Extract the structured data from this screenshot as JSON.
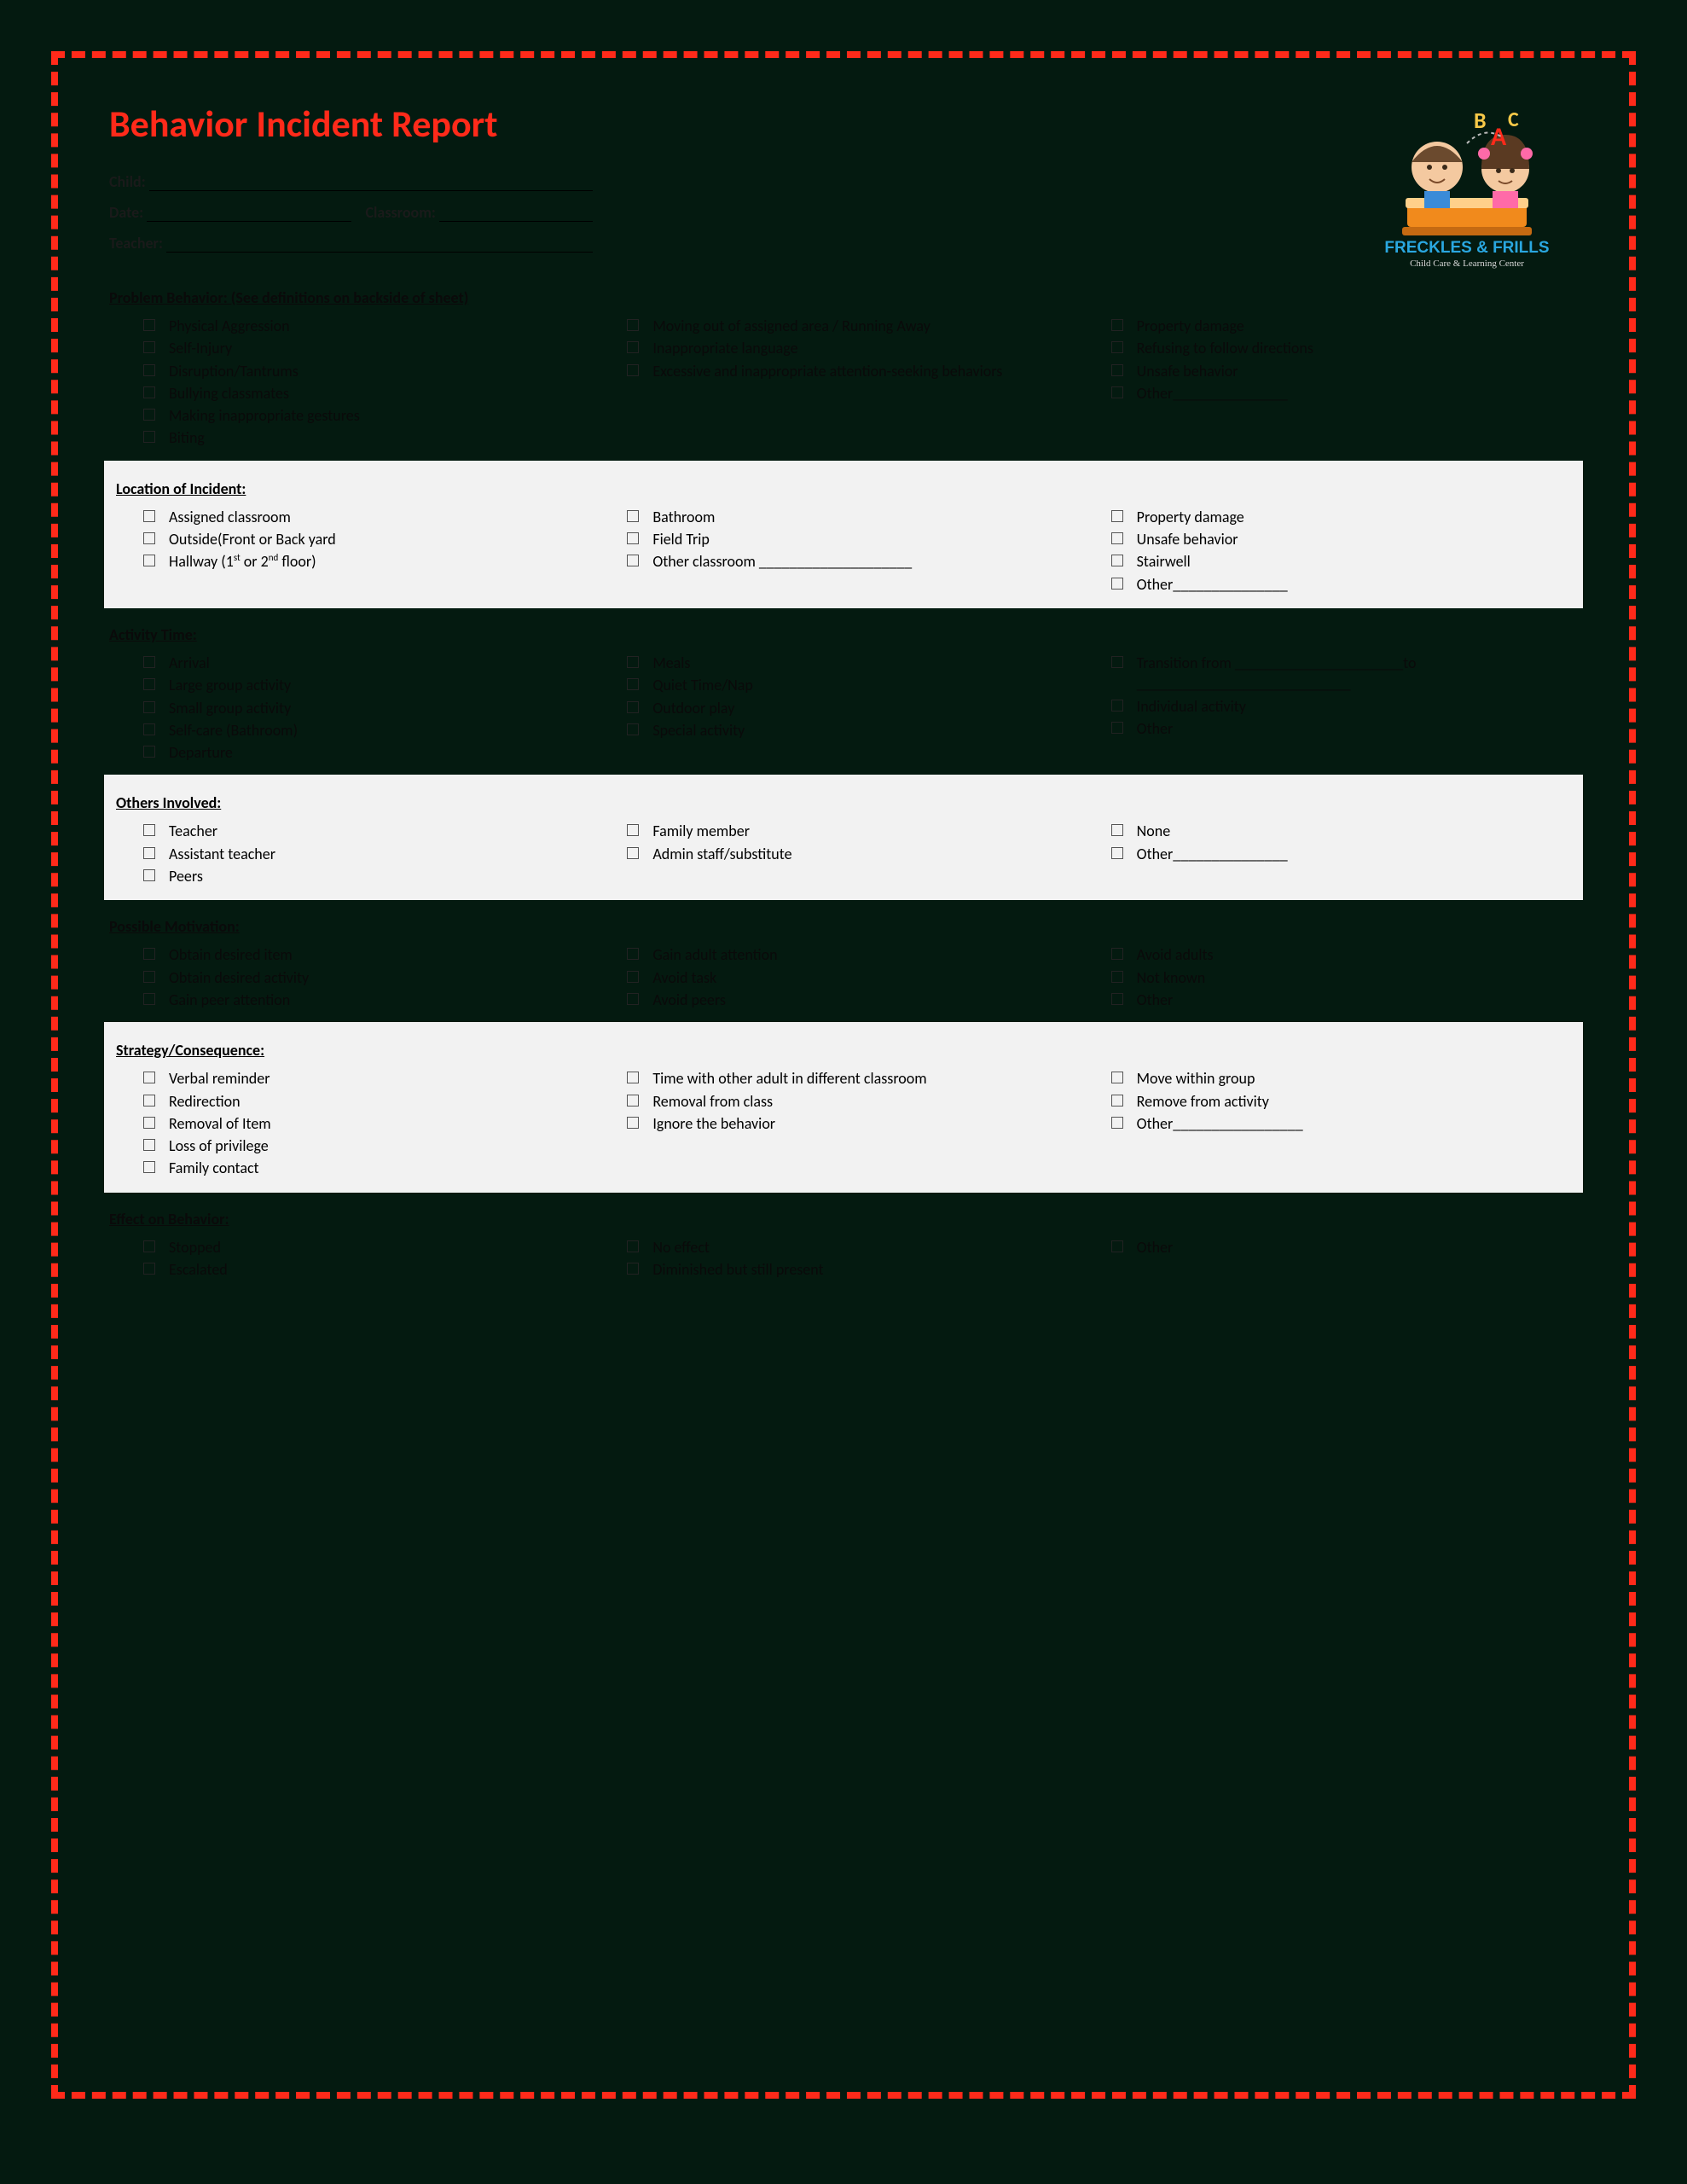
{
  "title": "Behavior Incident Report",
  "logo": {
    "brand_top": "FRECKLES & FRILLS",
    "brand_sub": "Child Care & Learning Center"
  },
  "fields": {
    "child_label": "Child:",
    "date_label": "Date:",
    "classroom_label": "Classroom:",
    "teacher_label": "Teacher:"
  },
  "sections": {
    "problem": {
      "heading": "Problem Behavior: (See definitions on backside of sheet)",
      "c1": [
        "Physical Aggression",
        "Self-Injury",
        "Disruption/Tantrums",
        "Bullying classmates",
        "Making inappropriate gestures",
        "Biting"
      ],
      "c2": [
        "Moving out of assigned area / Running Away",
        "Inappropriate language",
        "Excessive and inappropriate attention-seeking behaviors"
      ],
      "c3": [
        "Property damage",
        "Refusing to follow directions",
        "Unsafe behavior",
        "Other_______________"
      ]
    },
    "location": {
      "heading": "Location of Incident:",
      "c1": [
        "Assigned classroom",
        "Outside(Front or Back yard",
        "Hallway (1st or 2nd floor)"
      ],
      "c2": [
        "Bathroom",
        "Field Trip",
        "Other classroom ____________________"
      ],
      "c3": [
        "Property damage",
        "Unsafe behavior",
        "Stairwell",
        "Other_______________"
      ]
    },
    "activity": {
      "heading": "Activity Time:",
      "c1": [
        "Arrival",
        "Large group activity",
        "Small group activity",
        "Self-care (Bathroom)",
        "Departure"
      ],
      "c2": [
        "Meals",
        "Quiet Time/Nap",
        "Outdoor play",
        "Special activity"
      ],
      "c3": [
        "Transition  from ______________________to ____________________________",
        "Individual activity",
        "Other"
      ]
    },
    "others": {
      "heading": "Others Involved:",
      "c1": [
        "Teacher",
        "Assistant teacher",
        "Peers"
      ],
      "c2": [
        "Family member",
        "Admin staff/substitute"
      ],
      "c3": [
        "None",
        "Other_______________"
      ]
    },
    "motivation": {
      "heading": "Possible Motivation:",
      "c1": [
        "Obtain desired item",
        "Obtain desired activity",
        "Gain peer attention"
      ],
      "c2": [
        "Gain adult attention",
        "Avoid task",
        "Avoid peers"
      ],
      "c3": [
        "Avoid adults",
        "Not known",
        "Other"
      ]
    },
    "strategy": {
      "heading": "Strategy/Consequence:",
      "c1": [
        "Verbal reminder",
        "Redirection",
        "Removal of Item",
        "Loss of privilege",
        "Family contact"
      ],
      "c2": [
        "Time with other adult in different classroom",
        "Removal from class",
        "Ignore the behavior"
      ],
      "c3": [
        "Move within group",
        "Remove from activity",
        "Other_________________"
      ]
    },
    "effect": {
      "heading": "Effect on Behavior:",
      "c1": [
        "Stopped",
        "Escalated"
      ],
      "c2": [
        "No effect",
        "Diminished but still present"
      ],
      "c3": [
        "Other"
      ]
    }
  }
}
